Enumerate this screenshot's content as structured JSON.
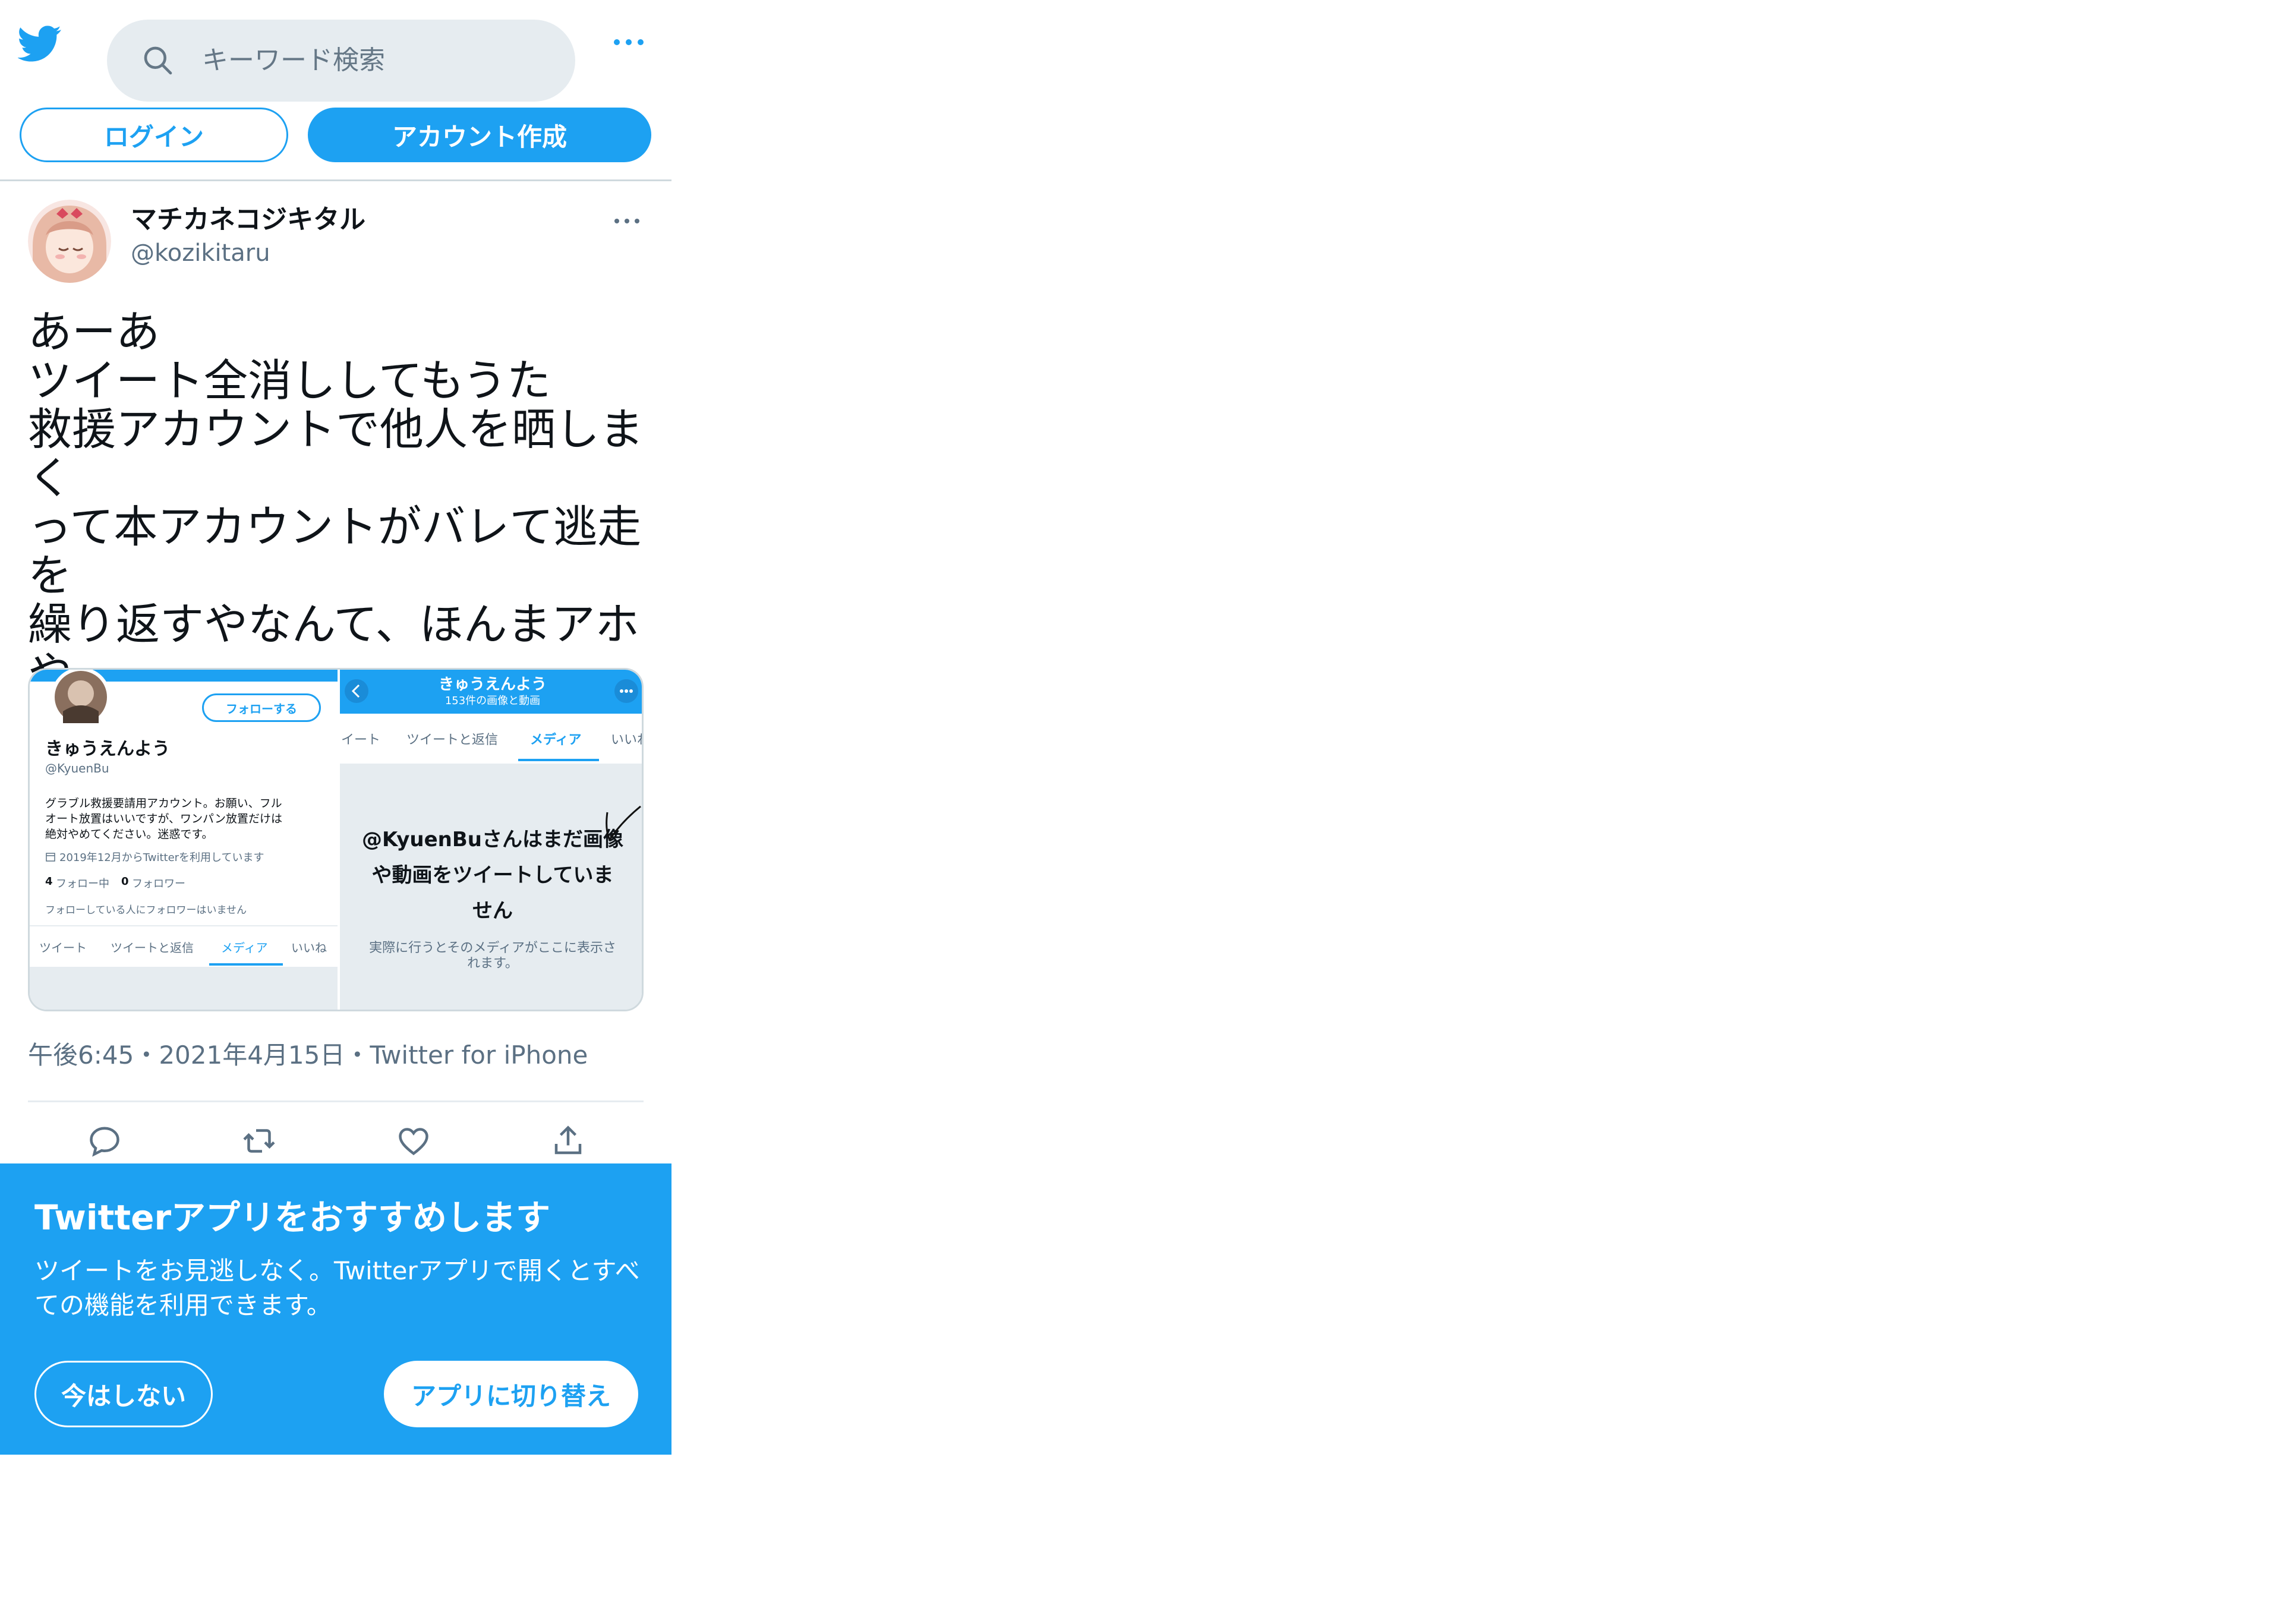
{
  "header": {
    "search_placeholder": "キーワード検索",
    "login_label": "ログイン",
    "signup_label": "アカウント作成"
  },
  "tweet": {
    "display_name": "マチカネコジキタル",
    "handle": "@kozikitaru",
    "text": "あーあ\nツイート全消ししてもうた\n救援アカウントで他人を晒しまく\nって本アカウントがバレて逃走を\n繰り返すやなんて、ほんまアホや\nなぁ\n一度目で学びいや",
    "meta": "午後6:45・2021年4月15日・Twitter for iPhone"
  },
  "media": {
    "left": {
      "follow_label": "フォローする",
      "name": "きゅうえんよう",
      "handle": "@KyuenBu",
      "bio_1": "グラブル救援要請用アカウント。お願い、フル",
      "bio_2": "オート放置はいいですが、ワンパン放置だけは",
      "bio_3": "絶対やめてください。迷惑です。",
      "joined": "2019年12月からTwitterを利用しています",
      "following_count": "4",
      "following_label": "フォロー中",
      "followers_count": "0",
      "followers_label": "フォロワー",
      "mutual": "フォローしている人にフォロワーはいません",
      "tabs": [
        "ツイート",
        "ツイートと返信",
        "メディア",
        "いいね"
      ]
    },
    "right": {
      "title": "きゅうえんよう",
      "subtitle": "153件の画像と動画",
      "tabs": [
        "イート",
        "ツイートと返信",
        "メディア",
        "いいね"
      ],
      "empty_1": "@KyuenBuさんはまだ画像",
      "empty_2": "や動画をツイートしていま",
      "empty_3": "せん",
      "empty_note_1": "実際に行うとそのメディアがここに表示さ",
      "empty_note_2": "れます。"
    }
  },
  "banner": {
    "title": "Twitterアプリをおすすめします",
    "body": "ツイートをお見逃しなく。Twitterアプリで開くとすべての機能を利用できます。",
    "not_now_label": "今はしない",
    "switch_label": "アプリに切り替え"
  },
  "icons": {
    "logo": "twitter-bird-icon",
    "search": "search-icon",
    "more": "more-dots-icon",
    "reply": "reply-icon",
    "retweet": "retweet-icon",
    "like": "heart-icon",
    "share": "share-icon"
  },
  "colors": {
    "brand": "#1da1f2",
    "search_bg": "#e6ecf0",
    "secondary_text": "#5b7083"
  }
}
